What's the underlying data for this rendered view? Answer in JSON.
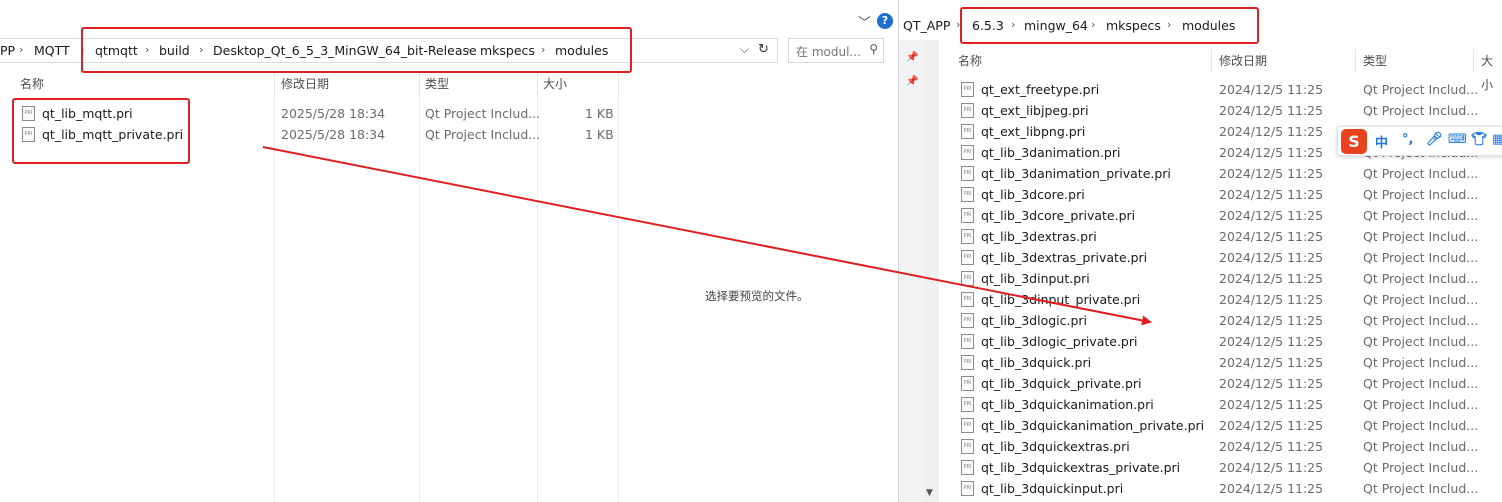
{
  "left_window": {
    "breadcrumb": [
      "PP",
      "MQTT",
      "qtmqtt",
      "build",
      "Desktop_Qt_6_5_3_MinGW_64_bit-Release",
      "mkspecs",
      "modules"
    ],
    "search_placeholder": "在 modul...",
    "columns": {
      "name": "名称",
      "date": "修改日期",
      "type": "类型",
      "size": "大小"
    },
    "files": [
      {
        "name": "qt_lib_mqtt.pri",
        "date": "2025/5/28 18:34",
        "type": "Qt Project Includ...",
        "size": "1 KB"
      },
      {
        "name": "qt_lib_mqtt_private.pri",
        "date": "2025/5/28 18:34",
        "type": "Qt Project Includ...",
        "size": "1 KB"
      }
    ],
    "preview_message": "选择要预览的文件。",
    "help_label": "?"
  },
  "right_window": {
    "breadcrumb": [
      "QT_APP",
      "6.5.3",
      "mingw_64",
      "mkspecs",
      "modules"
    ],
    "columns": {
      "name": "名称",
      "date": "修改日期",
      "type": "类型",
      "size": "大小"
    },
    "files": [
      {
        "name": "qt_ext_freetype.pri",
        "date": "2024/12/5 11:25",
        "type": "Qt Project Includ..."
      },
      {
        "name": "qt_ext_libjpeg.pri",
        "date": "2024/12/5 11:25",
        "type": "Qt Project Includ..."
      },
      {
        "name": "qt_ext_libpng.pri",
        "date": "2024/12/5 11:25",
        "type": "Qt Project Includ..."
      },
      {
        "name": "qt_lib_3danimation.pri",
        "date": "2024/12/5 11:25",
        "type": "Qt Project Includ..."
      },
      {
        "name": "qt_lib_3danimation_private.pri",
        "date": "2024/12/5 11:25",
        "type": "Qt Project Includ..."
      },
      {
        "name": "qt_lib_3dcore.pri",
        "date": "2024/12/5 11:25",
        "type": "Qt Project Includ..."
      },
      {
        "name": "qt_lib_3dcore_private.pri",
        "date": "2024/12/5 11:25",
        "type": "Qt Project Includ..."
      },
      {
        "name": "qt_lib_3dextras.pri",
        "date": "2024/12/5 11:25",
        "type": "Qt Project Includ..."
      },
      {
        "name": "qt_lib_3dextras_private.pri",
        "date": "2024/12/5 11:25",
        "type": "Qt Project Includ..."
      },
      {
        "name": "qt_lib_3dinput.pri",
        "date": "2024/12/5 11:25",
        "type": "Qt Project Includ..."
      },
      {
        "name": "qt_lib_3dinput_private.pri",
        "date": "2024/12/5 11:25",
        "type": "Qt Project Includ..."
      },
      {
        "name": "qt_lib_3dlogic.pri",
        "date": "2024/12/5 11:25",
        "type": "Qt Project Includ..."
      },
      {
        "name": "qt_lib_3dlogic_private.pri",
        "date": "2024/12/5 11:25",
        "type": "Qt Project Includ..."
      },
      {
        "name": "qt_lib_3dquick.pri",
        "date": "2024/12/5 11:25",
        "type": "Qt Project Includ..."
      },
      {
        "name": "qt_lib_3dquick_private.pri",
        "date": "2024/12/5 11:25",
        "type": "Qt Project Includ..."
      },
      {
        "name": "qt_lib_3dquickanimation.pri",
        "date": "2024/12/5 11:25",
        "type": "Qt Project Includ..."
      },
      {
        "name": "qt_lib_3dquickanimation_private.pri",
        "date": "2024/12/5 11:25",
        "type": "Qt Project Includ..."
      },
      {
        "name": "qt_lib_3dquickextras.pri",
        "date": "2024/12/5 11:25",
        "type": "Qt Project Includ..."
      },
      {
        "name": "qt_lib_3dquickextras_private.pri",
        "date": "2024/12/5 11:25",
        "type": "Qt Project Includ..."
      },
      {
        "name": "qt_lib_3dquickinput.pri",
        "date": "2024/12/5 11:25",
        "type": "Qt Project Includ..."
      }
    ]
  },
  "ime_toolbar": {
    "logo": "S",
    "mode_label": "中",
    "punct_label": "°,",
    "icons": [
      "mic-icon",
      "keyboard-icon",
      "skin-icon",
      "grid-icon"
    ]
  },
  "annotation_color": "#e02020",
  "file_icon_label": "PRI"
}
